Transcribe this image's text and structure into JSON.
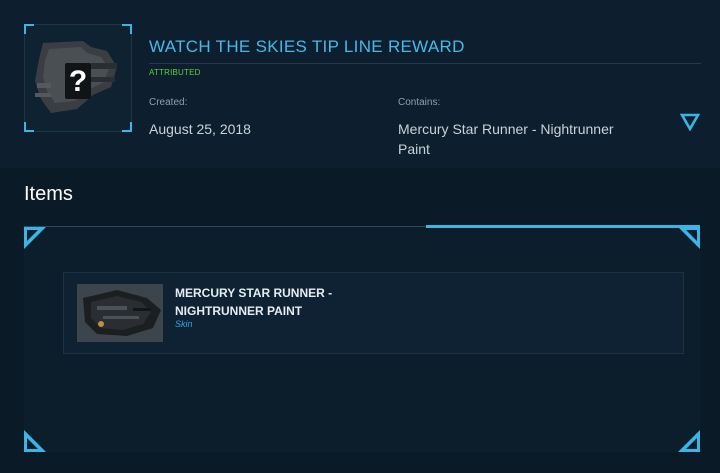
{
  "pledge": {
    "title": "WATCH THE SKIES TIP LINE REWARD",
    "status": "ATTRIBUTED",
    "created_label": "Created:",
    "created_value": "August 25, 2018",
    "contains_label": "Contains:",
    "contains_value": "Mercury Star Runner - Nightrunner Paint",
    "thumbnail_icon": "question-mark-icon"
  },
  "items_section": {
    "heading": "Items",
    "items": [
      {
        "name": "MERCURY STAR RUNNER - NIGHTRUNNER PAINT",
        "kind": "Skin"
      }
    ]
  },
  "colors": {
    "accent": "#3ab5e6",
    "title": "#45b9ea",
    "status": "#59d335",
    "background": "#0b1a27"
  }
}
